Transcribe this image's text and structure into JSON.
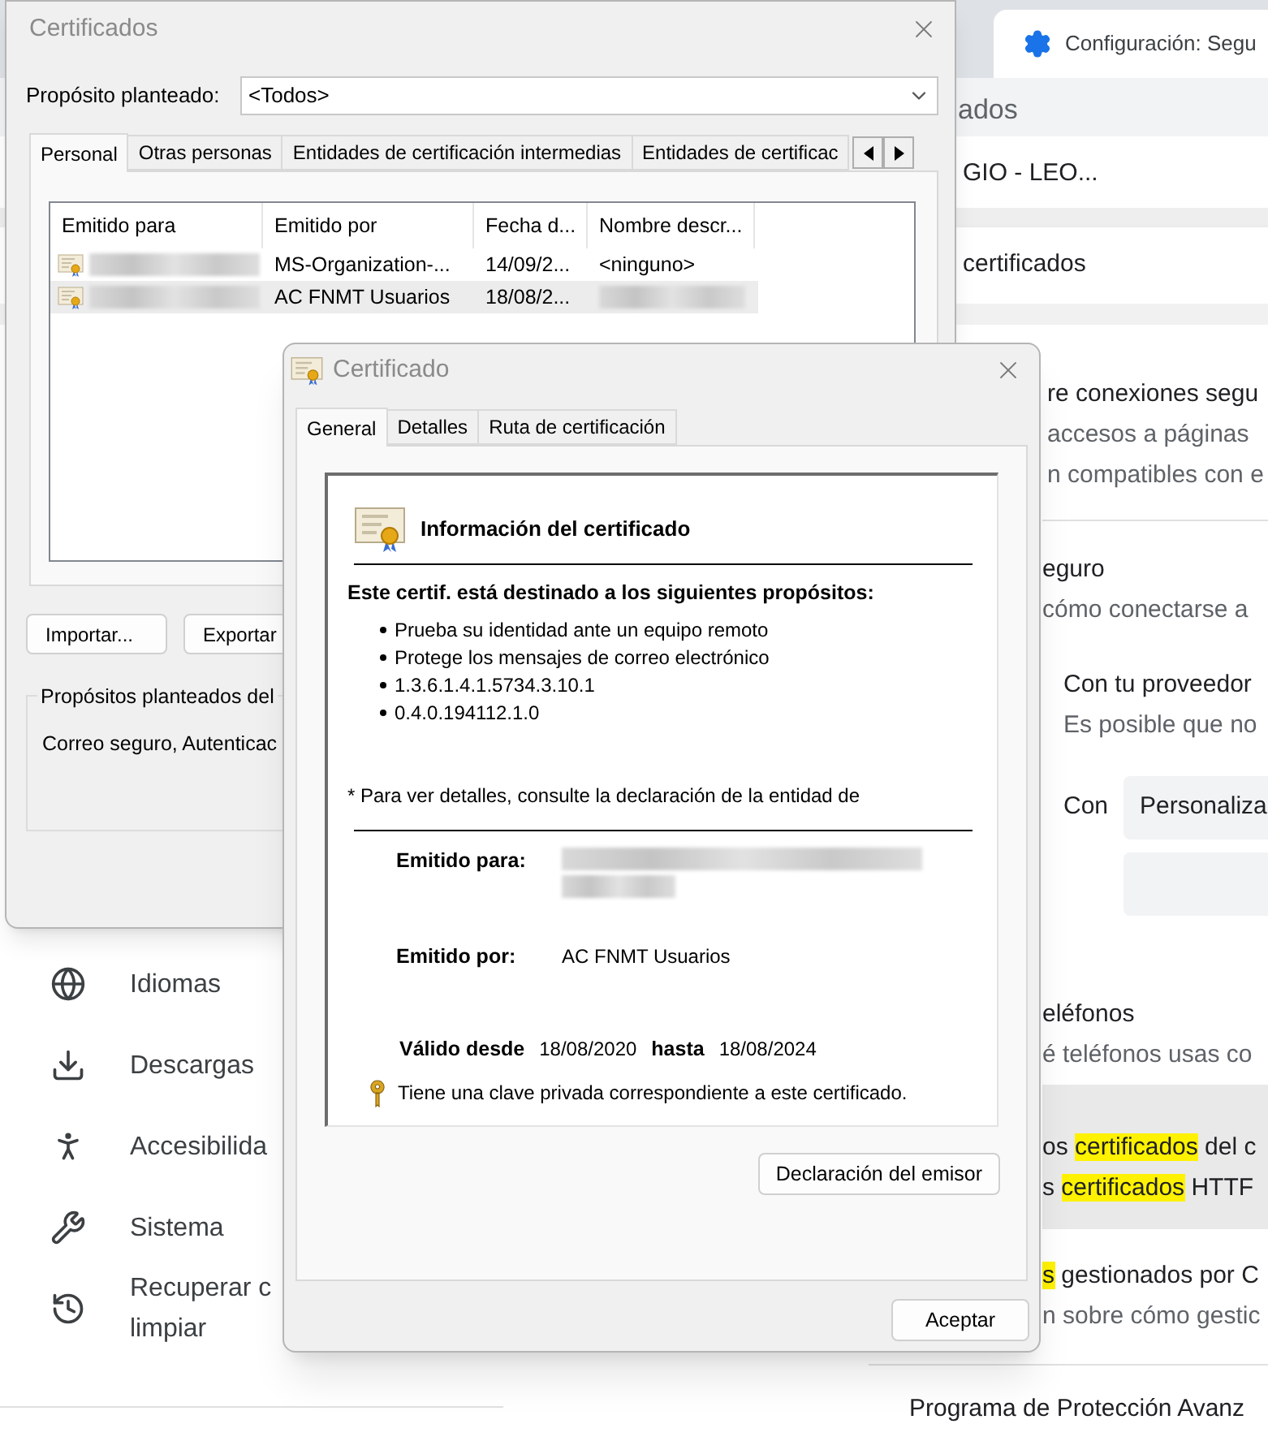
{
  "browser": {
    "tab_title": "Configuración: Segu",
    "heading": "ados",
    "profile": "GIO - LEO...",
    "section": "certificados",
    "blocks": [
      {
        "highlighted": false,
        "lines": [
          {
            "secondary": false,
            "segments": [
              {
                "text": "re conexiones segu",
                "highlight": false
              }
            ]
          },
          {
            "secondary": true,
            "segments": [
              {
                "text": "accesos a páginas",
                "highlight": false
              }
            ]
          },
          {
            "secondary": true,
            "segments": [
              {
                "text": "n compatibles con e",
                "highlight": false
              }
            ]
          }
        ]
      },
      {
        "highlighted": false,
        "lines": [
          {
            "secondary": false,
            "segments": [
              {
                "text": "eguro",
                "highlight": false
              }
            ]
          },
          {
            "secondary": true,
            "segments": [
              {
                "text": "cómo conectarse a",
                "highlight": false
              }
            ]
          }
        ]
      },
      {
        "highlighted": false,
        "lines": [
          {
            "secondary": false,
            "segments": [
              {
                "text": "Con tu proveedor",
                "highlight": false
              }
            ]
          },
          {
            "secondary": true,
            "segments": [
              {
                "text": "Es posible que no",
                "highlight": false
              }
            ]
          }
        ]
      },
      {
        "highlighted": false,
        "lines": [
          {
            "secondary": false,
            "segments": [
              {
                "text": "eléfonos",
                "highlight": false
              }
            ]
          },
          {
            "secondary": true,
            "segments": [
              {
                "text": "é teléfonos usas co",
                "highlight": false
              }
            ]
          }
        ]
      },
      {
        "highlighted": true,
        "lines": [
          {
            "secondary": false,
            "segments": [
              {
                "text": "os ",
                "highlight": false
              },
              {
                "text": "certificados",
                "highlight": true
              },
              {
                "text": " del c",
                "highlight": false
              }
            ]
          },
          {
            "secondary": false,
            "segments": [
              {
                "text": "s ",
                "highlight": false
              },
              {
                "text": "certificados",
                "highlight": true
              },
              {
                "text": " HTTF",
                "highlight": false
              }
            ]
          }
        ]
      },
      {
        "highlighted": false,
        "lines": [
          {
            "secondary": false,
            "segments": [
              {
                "text": "s",
                "highlight": true
              },
              {
                "text": " gestionados por C",
                "highlight": false
              }
            ]
          },
          {
            "secondary": true,
            "segments": [
              {
                "text": "n sobre cómo gestic",
                "highlight": false
              }
            ]
          }
        ]
      }
    ],
    "dns_row": {
      "label": "Con",
      "field_value": "Personaliza"
    },
    "footer_item": "Programa de Protección Avanz"
  },
  "sidebar": {
    "items": [
      {
        "lines": [
          "Idiomas"
        ]
      },
      {
        "lines": [
          "Descargas"
        ]
      },
      {
        "lines": [
          "Accesibilida"
        ]
      },
      {
        "lines": [
          "Sistema"
        ]
      },
      {
        "lines": [
          "Recuperar c",
          "limpiar"
        ]
      }
    ]
  },
  "certificates_dialog": {
    "title": "Certificados",
    "purpose_label": "Propósito planteado:",
    "purpose_value": "<Todos>",
    "tabs": [
      {
        "label": "Personal",
        "selected": true
      },
      {
        "label": "Otras personas",
        "selected": false
      },
      {
        "label": "Entidades de certificación intermedias",
        "selected": false
      },
      {
        "label": "Entidades de certificac",
        "selected": false
      }
    ],
    "columns": [
      "Emitido para",
      "Emitido por",
      "Fecha d...",
      "Nombre descr..."
    ],
    "rows": [
      {
        "issued_by": "MS-Organization-...",
        "date": "14/09/2...",
        "friendly_name": "<ninguno>",
        "selected": false
      },
      {
        "issued_by": "AC FNMT Usuarios",
        "date": "18/08/2...",
        "selected": true
      }
    ],
    "buttons": [
      "Importar...",
      "Exportar"
    ],
    "purposes_group": {
      "title": "Propósitos planteados del",
      "text": "Correo seguro, Autenticac"
    }
  },
  "certificate_dialog": {
    "title": "Certificado",
    "tabs": [
      {
        "label": "General",
        "selected": true
      },
      {
        "label": "Detalles",
        "selected": false
      },
      {
        "label": "Ruta de certificación",
        "selected": false
      }
    ],
    "info_title": "Información del certificado",
    "purposes_heading": "Este certif. está destinado a los siguientes propósitos:",
    "purposes": [
      "Prueba su identidad ante un equipo remoto",
      "Protege los mensajes de correo electrónico",
      "1.3.6.1.4.1.5734.3.10.1",
      "0.4.0.194112.1.0"
    ],
    "note": "* Para ver detalles, consulte la declaración de la entidad de",
    "issued_to_label": "Emitido para:",
    "issued_by_label": "Emitido por:",
    "issued_by": "AC FNMT Usuarios",
    "valid_from_label": "Válido desde",
    "valid_from": "18/08/2020",
    "valid_to_label": "hasta",
    "valid_to": "18/08/2024",
    "private_key_note": "Tiene una clave privada correspondiente a este certificado.",
    "issuer_statement_button": "Declaración del emisor",
    "ok_button": "Aceptar"
  }
}
